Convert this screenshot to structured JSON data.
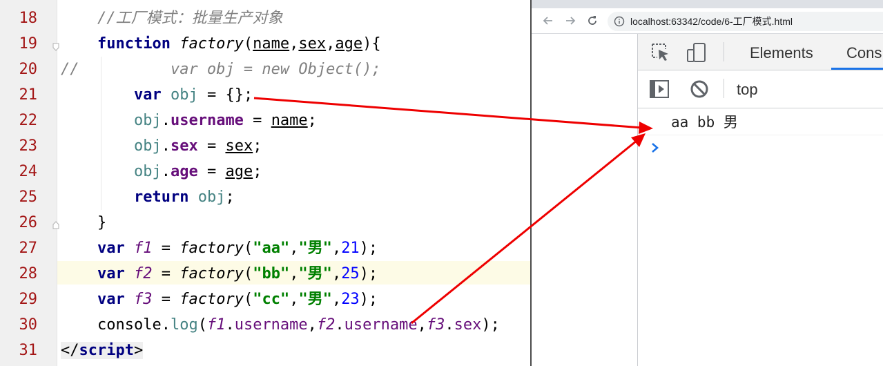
{
  "editor": {
    "line_numbers": [
      "18",
      "19",
      "20",
      "21",
      "22",
      "23",
      "24",
      "25",
      "26",
      "27",
      "28",
      "29",
      "30",
      "31"
    ],
    "code": {
      "l18": {
        "comment": "//工厂模式：批量生产对象"
      },
      "l19": {
        "kw": "function",
        "fname": "factory",
        "open": "(",
        "p1": "name",
        "comma1": ",",
        "p2": "sex",
        "comma2": ",",
        "p3": "age",
        "close": "){"
      },
      "l20": {
        "comment_mark": "//",
        "comment": "var obj = new Object();"
      },
      "l21": {
        "kw": "var",
        "var": "obj",
        "rest": " = {};"
      },
      "l22": {
        "obj": "obj",
        "dot": ".",
        "prop": "username",
        "eq": " = ",
        "val": "name",
        "semi": ";"
      },
      "l23": {
        "obj": "obj",
        "dot": ".",
        "prop": "sex",
        "eq": " = ",
        "val": "sex",
        "semi": ";"
      },
      "l24": {
        "obj": "obj",
        "dot": ".",
        "prop": "age",
        "eq": " = ",
        "val": "age",
        "semi": ";"
      },
      "l25": {
        "kw": "return",
        "var": "obj",
        "semi": ";"
      },
      "l26": {
        "brace": "}"
      },
      "l27": {
        "kw": "var",
        "name": "f1",
        "eq": " = ",
        "fname": "factory",
        "open": "(",
        "s1": "\"aa\"",
        "c1": ",",
        "s2": "\"男\"",
        "c2": ",",
        "num": "21",
        "close": ");"
      },
      "l28": {
        "kw": "var",
        "name": "f2",
        "eq": " = ",
        "fname": "factory",
        "open": "(",
        "s1": "\"bb\"",
        "c1": ",",
        "s2": "\"男\"",
        "c2": ",",
        "num": "25",
        "close": ");"
      },
      "l29": {
        "kw": "var",
        "name": "f3",
        "eq": " = ",
        "fname": "factory",
        "open": "(",
        "s1": "\"cc\"",
        "c1": ",",
        "s2": "\"男\"",
        "c2": ",",
        "num": "23",
        "close": ");"
      },
      "l30": {
        "obj": "console",
        "dot": ".",
        "fn": "log",
        "open": "(",
        "a1": "f1",
        "d1": ".",
        "pa1": "username",
        "c1": ",",
        "a2": "f2",
        "d2": ".",
        "pa2": "username",
        "c2": ",",
        "a3": "f3",
        "d3": ".",
        "pa3": "sex",
        "close": ");"
      },
      "l31": {
        "open": "</",
        "tag": "script",
        "close": ">"
      }
    }
  },
  "browser": {
    "url": "localhost:63342/code/6-工厂模式.html",
    "devtools": {
      "tabs": {
        "elements": "Elements",
        "console": "Cons"
      },
      "context": "top",
      "console_output": "aa bb 男"
    }
  },
  "icons": {
    "back": "arrow-left-icon",
    "forward": "arrow-right-icon",
    "reload": "reload-icon",
    "info": "info-icon",
    "inspect": "inspect-element-icon",
    "device": "device-toggle-icon",
    "sidebar": "sidebar-toggle-icon",
    "clear": "clear-console-icon",
    "prompt": "chevron-right-icon"
  },
  "colors": {
    "keyword": "#000080",
    "comment": "#808080",
    "string": "#008000",
    "number": "#0000ff",
    "property": "#660e7a",
    "variable": "#458383",
    "line_number": "#a31515",
    "arrow": "#ee0000",
    "tab_active": "#1a73e8"
  }
}
